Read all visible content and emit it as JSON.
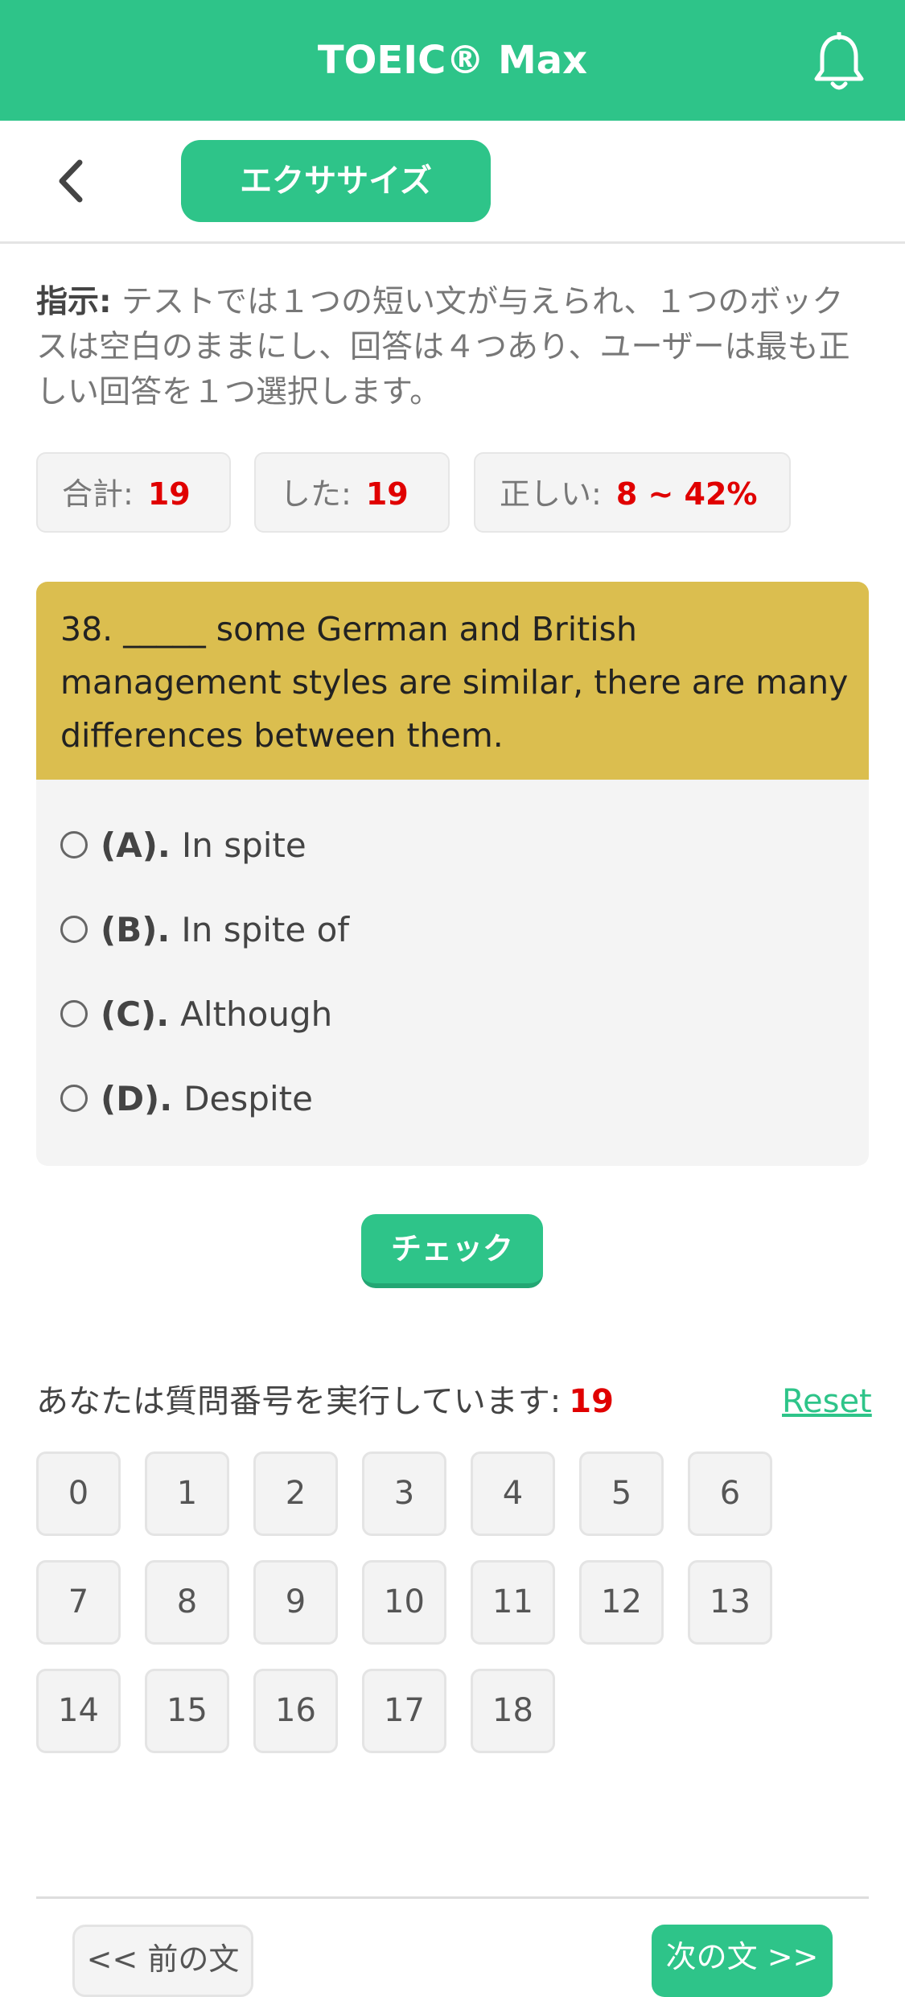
{
  "app": {
    "title": "TOEIC® Max",
    "colors": {
      "brand": "#2ec489",
      "question_header": "#dbbe4f",
      "highlight": "#e00000"
    }
  },
  "header": {
    "notification_icon": "bell-icon",
    "back_icon": "chevron-left-icon",
    "exercise_label": "エクササイズ"
  },
  "instruction": {
    "label": "指示:",
    "text": " テストでは１つの短い文が与えられ、１つのボックスは空白のままにし、回答は４つあり、ユーザーは最も正しい回答を１つ選択します。"
  },
  "stats": {
    "total_label": "合計:",
    "total_value": "19",
    "done_label": "した:",
    "done_value": "19",
    "correct_label": "正しい:",
    "correct_value": "8 ~ 42%"
  },
  "question": {
    "text": "38. _____ some German and British management styles are similar, there are many differences between them.",
    "options": [
      {
        "letter": "(A).",
        "text": "In spite"
      },
      {
        "letter": "(B).",
        "text": "In spite of"
      },
      {
        "letter": "(C).",
        "text": "Although"
      },
      {
        "letter": "(D).",
        "text": "Despite"
      }
    ]
  },
  "check_label": "チェック",
  "progress": {
    "label": "あなたは質問番号を実行しています:",
    "current": "19",
    "reset_label": "Reset",
    "numbers": [
      "0",
      "1",
      "2",
      "3",
      "4",
      "5",
      "6",
      "7",
      "8",
      "9",
      "10",
      "11",
      "12",
      "13",
      "14",
      "15",
      "16",
      "17",
      "18"
    ]
  },
  "footer": {
    "prev_label": "<< 前の文",
    "next_label": "次の文 >>"
  }
}
